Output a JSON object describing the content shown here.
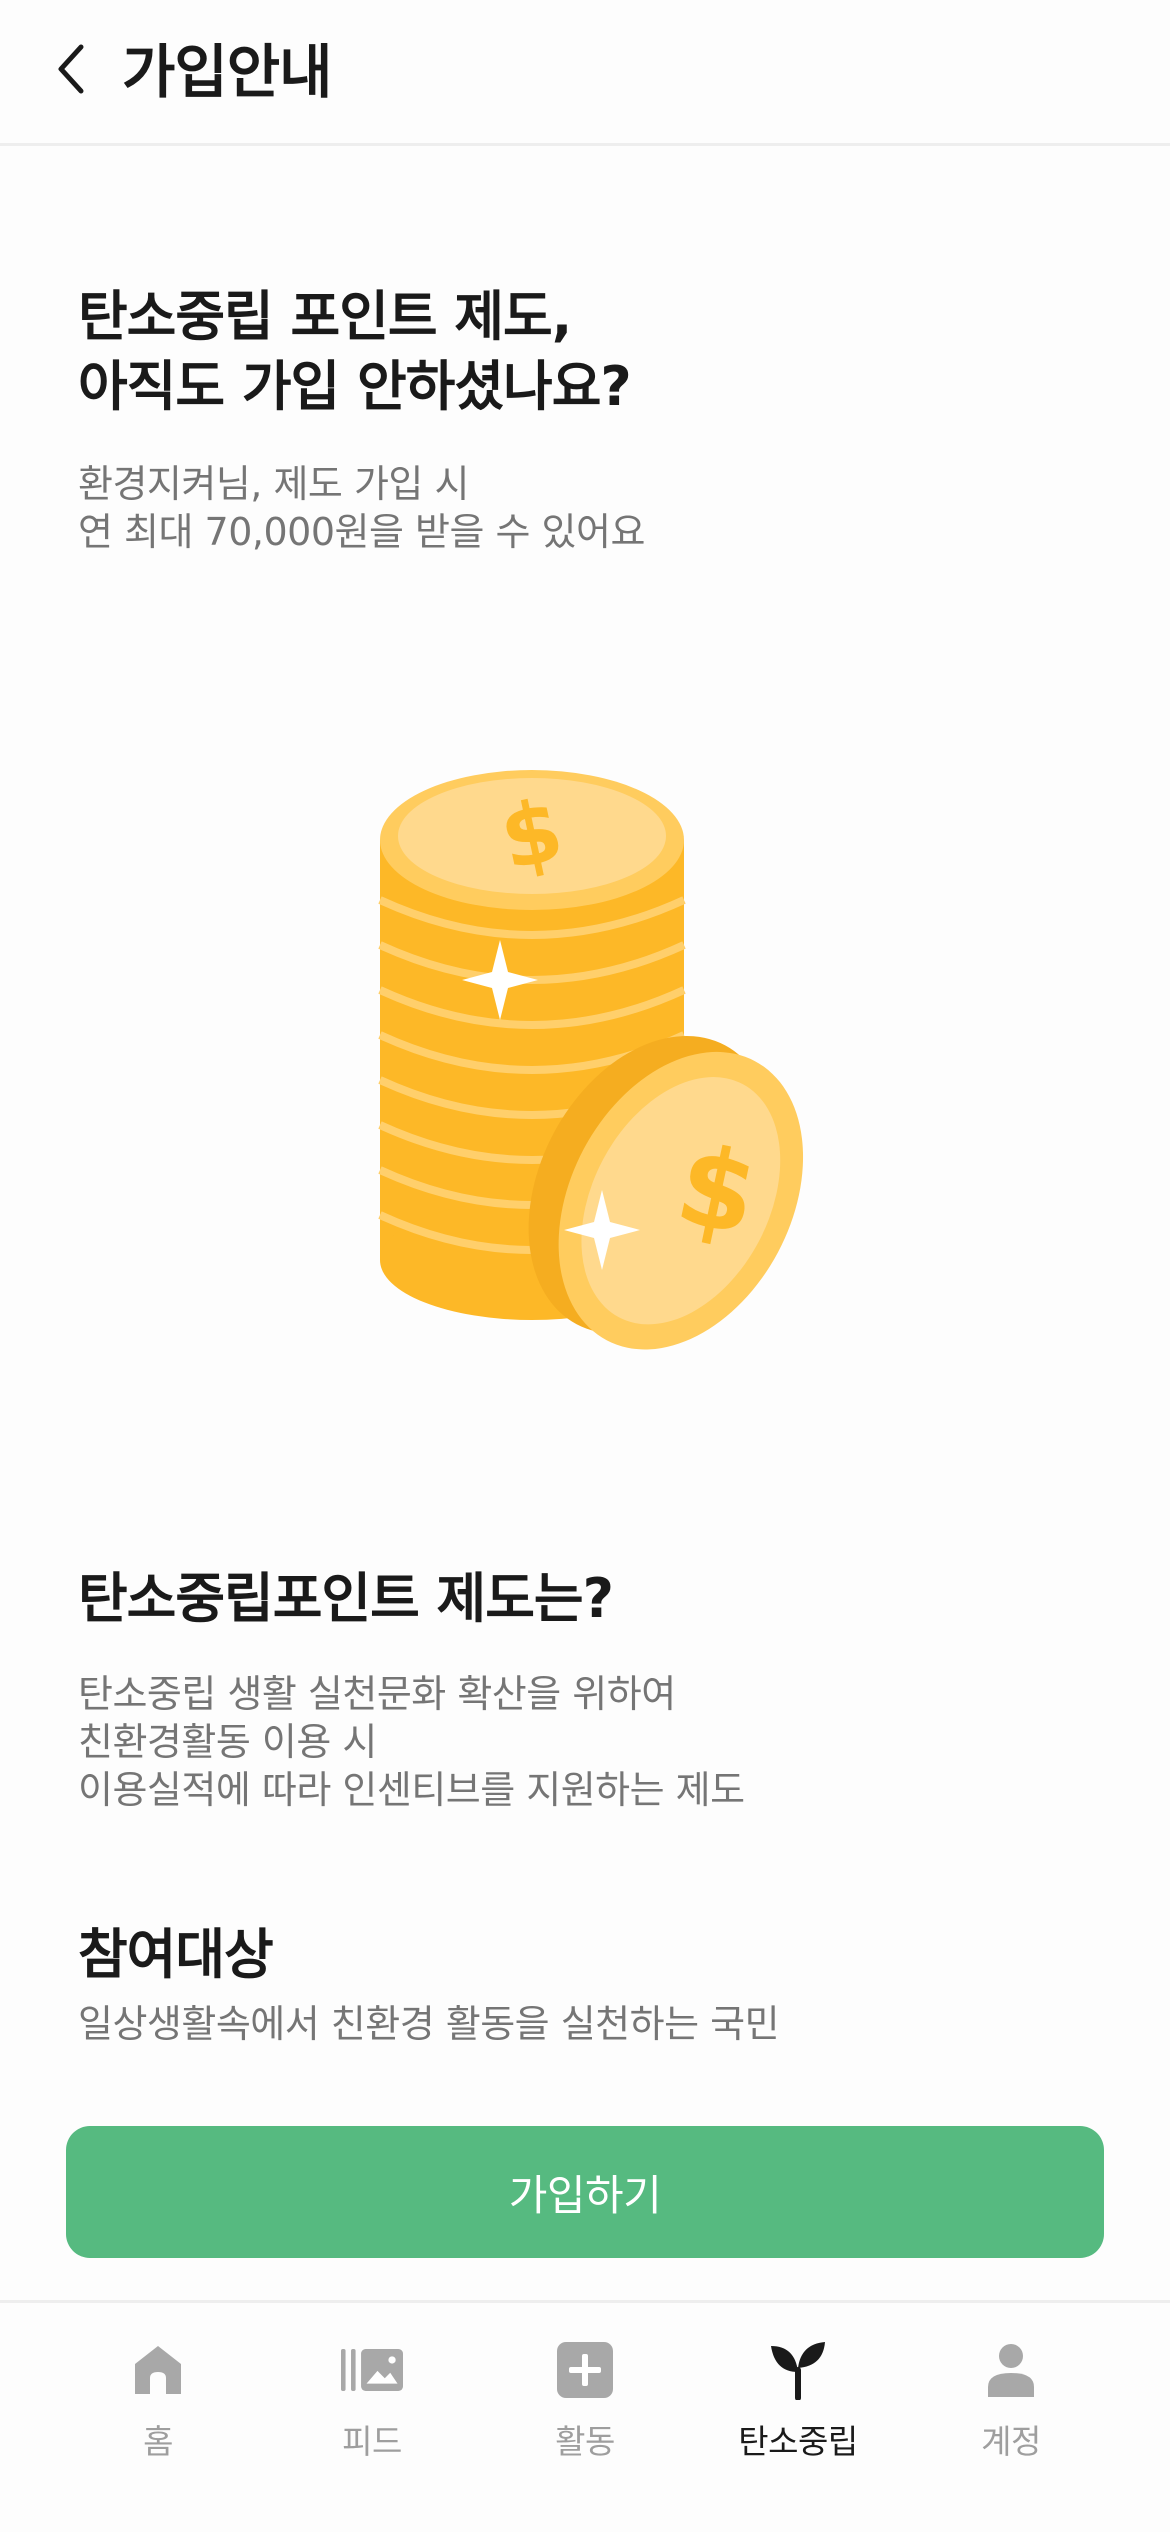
{
  "header": {
    "title": "가입안내",
    "back_icon": "chevron-left-icon"
  },
  "intro": {
    "headline_line1": "탄소중립 포인트 제도,",
    "headline_line2": "아직도 가입 안하셨나요?",
    "sub_line1": "환경지켜님, 제도 가입 시",
    "sub_line2": "연 최대 70,000원을 받을 수 있어요"
  },
  "illustration": {
    "icon": "gold-coins-dollar-illustration",
    "coin_symbol": "$",
    "colors": {
      "coin_main": "#fdb827",
      "coin_light": "#ffd98d",
      "coin_face": "#ffd98d"
    }
  },
  "about": {
    "title": "탄소중립포인트 제도는?",
    "line1": "탄소중립 생활 실천문화 확산을 위하여",
    "line2": "친환경활동 이용 시",
    "line3": "이용실적에 따라 인센티브를 지원하는 제도"
  },
  "target": {
    "title": "참여대상",
    "line1": "일상생활속에서 친환경 활동을 실천하는 국민"
  },
  "cta": {
    "label": "가입하기",
    "color": "#56ba80"
  },
  "nav": {
    "items": [
      {
        "label": "홈",
        "icon": "home-icon",
        "active": false
      },
      {
        "label": "피드",
        "icon": "feed-gallery-icon",
        "active": false
      },
      {
        "label": "활동",
        "icon": "plus-square-icon",
        "active": false
      },
      {
        "label": "탄소중립",
        "icon": "sprout-icon",
        "active": true
      },
      {
        "label": "계정",
        "icon": "person-icon",
        "active": false
      }
    ],
    "active_color": "#1a1a1a",
    "inactive_color": "#9e9e9e"
  }
}
